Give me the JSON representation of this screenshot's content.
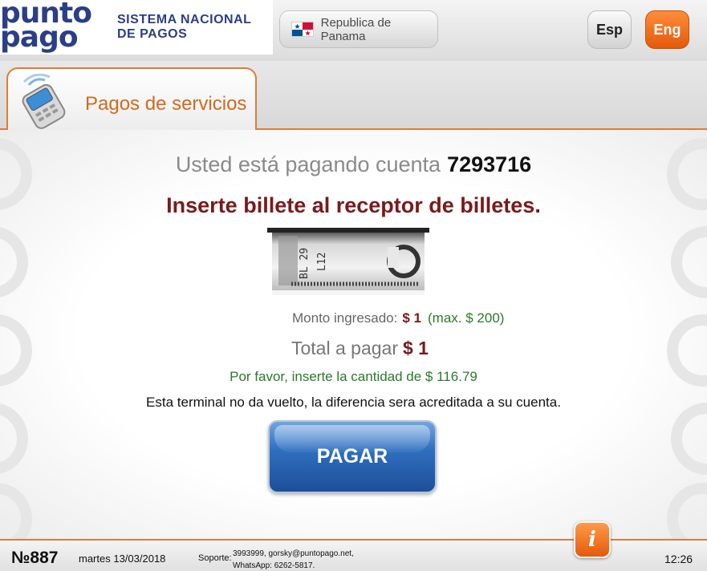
{
  "header": {
    "logo_line1": "punto",
    "logo_line2": "pago",
    "system_line1": "SISTEMA NACIONAL",
    "system_line2": "DE PAGOS",
    "country_label": "Republica de Panama",
    "lang_esp": "Esp",
    "lang_eng": "Eng"
  },
  "tab": {
    "label": "Pagos de servicios"
  },
  "payment": {
    "paying_prefix": "Usted está pagando cuenta",
    "account_number": "7293716",
    "instruction": "Inserte billete al receptor de billetes.",
    "bill_text_1": "BL 29",
    "bill_text_2": "L12",
    "amount_label": "Monto ingresado:",
    "amount_value": "$ 1",
    "amount_max": "(max. $ 200)",
    "total_label": "Total a pagar",
    "total_value": "$ 1",
    "insert_amount": "Por favor, inserte la cantidad de $ 116.79",
    "no_change_note": "Esta terminal no da vuelto, la diferencia sera acreditada a su cuenta.",
    "pay_button": "PAGAR"
  },
  "footer": {
    "terminal": "№887",
    "date": "martes 13/03/2018",
    "support_label": "Soporte:",
    "support_line1": "3993999, gorsky@puntopago.net,",
    "support_line2": "WhatsApp: 6262-5817.",
    "info_glyph": "i",
    "time": "12:26"
  },
  "colors": {
    "brand_blue": "#2b3f87",
    "accent_orange": "#e35a0a",
    "dark_red": "#7a1a1a",
    "green": "#2a7a2a"
  }
}
